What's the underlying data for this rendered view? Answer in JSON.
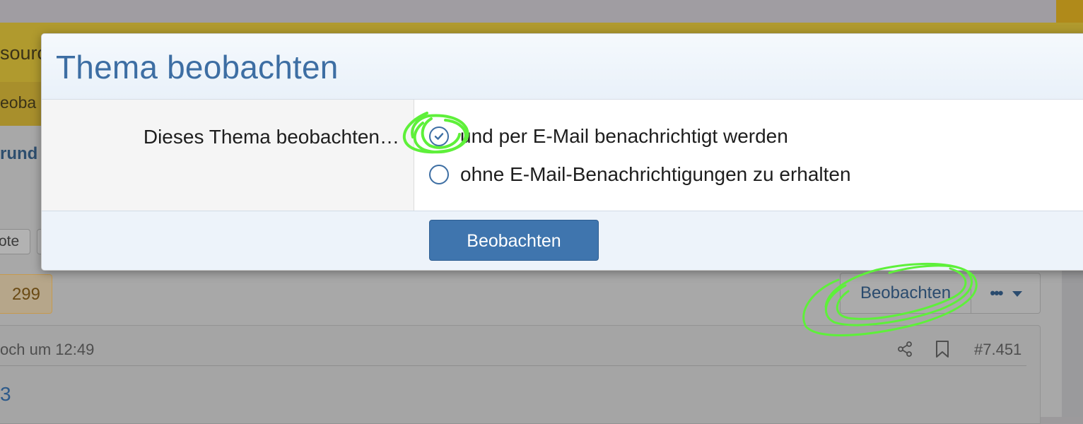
{
  "background": {
    "nav_tab_label": "sourc",
    "subnav_label": "eoba",
    "thread_title_fragment": "rund",
    "quote_button_label": "ote",
    "reaction_count": "299",
    "watch_button_label": "Beobachten",
    "more_button_label": "•••",
    "post": {
      "date_fragment": "och um 12:49",
      "post_number": "#7.451",
      "content_fragment": "3"
    }
  },
  "modal": {
    "title": "Thema beobachten",
    "row_label": "Dieses Thema beobachten…",
    "options": [
      {
        "label": "und per E-Mail benachrichtigt werden",
        "selected": true
      },
      {
        "label": "ohne E-Mail-Benachrichtigungen zu erhalten",
        "selected": false
      }
    ],
    "submit_label": "Beobachten"
  },
  "colors": {
    "accent": "#3d6ea3",
    "annotation": "#5ef03a"
  },
  "icons": {
    "share": "share-icon",
    "bookmark": "bookmark-icon",
    "more": "more-dots-icon",
    "caret": "caret-down-icon",
    "check": "check-icon"
  }
}
